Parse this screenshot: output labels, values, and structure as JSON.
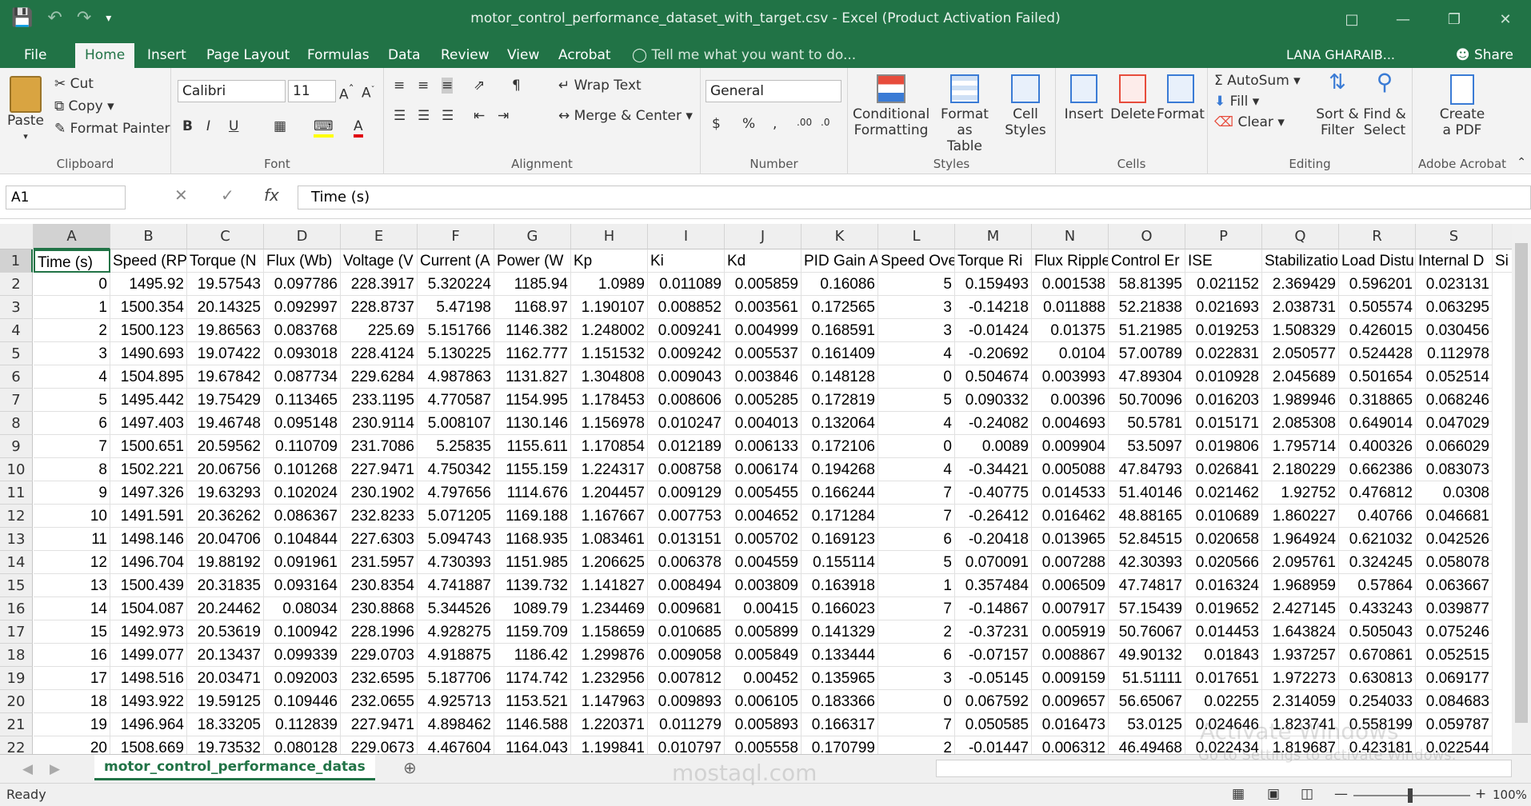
{
  "window": {
    "title": "motor_control_performance_dataset_with_target.csv - Excel (Product Activation Failed)",
    "user": "LANA GHARAIB...",
    "share_label": "Share"
  },
  "tabs": [
    "File",
    "Home",
    "Insert",
    "Page Layout",
    "Formulas",
    "Data",
    "Review",
    "View",
    "Acrobat"
  ],
  "tell_me": "Tell me what you want to do...",
  "ribbon": {
    "clipboard": {
      "paste": "Paste",
      "cut": "Cut",
      "copy": "Copy",
      "format_painter": "Format Painter",
      "label": "Clipboard"
    },
    "font": {
      "name": "Calibri",
      "size": "11",
      "label": "Font"
    },
    "alignment": {
      "wrap": "Wrap Text",
      "merge": "Merge & Center",
      "label": "Alignment"
    },
    "number": {
      "format": "General",
      "label": "Number"
    },
    "styles": {
      "conditional": "Conditional",
      "conditional2": "Formatting",
      "format_table": "Format as",
      "format_table2": "Table",
      "cell_styles": "Cell",
      "cell_styles2": "Styles",
      "label": "Styles"
    },
    "cells": {
      "insert": "Insert",
      "delete": "Delete",
      "format": "Format",
      "label": "Cells"
    },
    "editing": {
      "autosum": "AutoSum",
      "fill": "Fill",
      "clear": "Clear",
      "sort": "Sort &",
      "sort2": "Filter",
      "find": "Find &",
      "find2": "Select",
      "label": "Editing"
    },
    "acrobat": {
      "create": "Create",
      "create2": "a PDF",
      "label": "Adobe Acrobat"
    }
  },
  "formula_bar": {
    "name_box": "A1",
    "formula": "Time (s)"
  },
  "columns": [
    "A",
    "B",
    "C",
    "D",
    "E",
    "F",
    "G",
    "H",
    "I",
    "J",
    "K",
    "L",
    "M",
    "N",
    "O",
    "P",
    "Q",
    "R",
    "S"
  ],
  "headers": [
    "Time (s)",
    "Speed (RP",
    "Torque (N",
    "Flux (Wb)",
    "Voltage (V",
    "Current (A",
    "Power (W",
    "Kp",
    "Ki",
    "Kd",
    "PID Gain A",
    "Speed Ove",
    "Torque Ri",
    "Flux Ripple",
    "Control Er",
    "ISE",
    "Stabilizatio",
    "Load Distu",
    "Internal D",
    "Si"
  ],
  "rows": [
    [
      "0",
      "1495.92",
      "19.57543",
      "0.097786",
      "228.3917",
      "5.320224",
      "1185.94",
      "1.0989",
      "0.011089",
      "0.005859",
      "0.16086",
      "5",
      "0.159493",
      "0.001538",
      "58.81395",
      "0.021152",
      "2.369429",
      "0.596201",
      "0.023131"
    ],
    [
      "1",
      "1500.354",
      "20.14325",
      "0.092997",
      "228.8737",
      "5.47198",
      "1168.97",
      "1.190107",
      "0.008852",
      "0.003561",
      "0.172565",
      "3",
      "-0.14218",
      "0.011888",
      "52.21838",
      "0.021693",
      "2.038731",
      "0.505574",
      "0.063295"
    ],
    [
      "2",
      "1500.123",
      "19.86563",
      "0.083768",
      "225.69",
      "5.151766",
      "1146.382",
      "1.248002",
      "0.009241",
      "0.004999",
      "0.168591",
      "3",
      "-0.01424",
      "0.01375",
      "51.21985",
      "0.019253",
      "1.508329",
      "0.426015",
      "0.030456"
    ],
    [
      "3",
      "1490.693",
      "19.07422",
      "0.093018",
      "228.4124",
      "5.130225",
      "1162.777",
      "1.151532",
      "0.009242",
      "0.005537",
      "0.161409",
      "4",
      "-0.20692",
      "0.0104",
      "57.00789",
      "0.022831",
      "2.050577",
      "0.524428",
      "0.112978"
    ],
    [
      "4",
      "1504.895",
      "19.67842",
      "0.087734",
      "229.6284",
      "4.987863",
      "1131.827",
      "1.304808",
      "0.009043",
      "0.003846",
      "0.148128",
      "0",
      "0.504674",
      "0.003993",
      "47.89304",
      "0.010928",
      "2.045689",
      "0.501654",
      "0.052514"
    ],
    [
      "5",
      "1495.442",
      "19.75429",
      "0.113465",
      "233.1195",
      "4.770587",
      "1154.995",
      "1.178453",
      "0.008606",
      "0.005285",
      "0.172819",
      "5",
      "0.090332",
      "0.00396",
      "50.70096",
      "0.016203",
      "1.989946",
      "0.318865",
      "0.068246"
    ],
    [
      "6",
      "1497.403",
      "19.46748",
      "0.095148",
      "230.9114",
      "5.008107",
      "1130.146",
      "1.156978",
      "0.010247",
      "0.004013",
      "0.132064",
      "4",
      "-0.24082",
      "0.004693",
      "50.5781",
      "0.015171",
      "2.085308",
      "0.649014",
      "0.047029"
    ],
    [
      "7",
      "1500.651",
      "20.59562",
      "0.110709",
      "231.7086",
      "5.25835",
      "1155.611",
      "1.170854",
      "0.012189",
      "0.006133",
      "0.172106",
      "0",
      "0.0089",
      "0.009904",
      "53.5097",
      "0.019806",
      "1.795714",
      "0.400326",
      "0.066029"
    ],
    [
      "8",
      "1502.221",
      "20.06756",
      "0.101268",
      "227.9471",
      "4.750342",
      "1155.159",
      "1.224317",
      "0.008758",
      "0.006174",
      "0.194268",
      "4",
      "-0.34421",
      "0.005088",
      "47.84793",
      "0.026841",
      "2.180229",
      "0.662386",
      "0.083073"
    ],
    [
      "9",
      "1497.326",
      "19.63293",
      "0.102024",
      "230.1902",
      "4.797656",
      "1114.676",
      "1.204457",
      "0.009129",
      "0.005455",
      "0.166244",
      "7",
      "-0.40775",
      "0.014533",
      "51.40146",
      "0.021462",
      "1.92752",
      "0.476812",
      "0.0308"
    ],
    [
      "10",
      "1491.591",
      "20.36262",
      "0.086367",
      "232.8233",
      "5.071205",
      "1169.188",
      "1.167667",
      "0.007753",
      "0.004652",
      "0.171284",
      "7",
      "-0.26412",
      "0.016462",
      "48.88165",
      "0.010689",
      "1.860227",
      "0.40766",
      "0.046681"
    ],
    [
      "11",
      "1498.146",
      "20.04706",
      "0.104844",
      "227.6303",
      "5.094743",
      "1168.935",
      "1.083461",
      "0.013151",
      "0.005702",
      "0.169123",
      "6",
      "-0.20418",
      "0.013965",
      "52.84515",
      "0.020658",
      "1.964924",
      "0.621032",
      "0.042526"
    ],
    [
      "12",
      "1496.704",
      "19.88192",
      "0.091961",
      "231.5957",
      "4.730393",
      "1151.985",
      "1.206625",
      "0.006378",
      "0.004559",
      "0.155114",
      "5",
      "0.070091",
      "0.007288",
      "42.30393",
      "0.020566",
      "2.095761",
      "0.324245",
      "0.058078"
    ],
    [
      "13",
      "1500.439",
      "20.31835",
      "0.093164",
      "230.8354",
      "4.741887",
      "1139.732",
      "1.141827",
      "0.008494",
      "0.003809",
      "0.163918",
      "1",
      "0.357484",
      "0.006509",
      "47.74817",
      "0.016324",
      "1.968959",
      "0.57864",
      "0.063667"
    ],
    [
      "14",
      "1504.087",
      "20.24462",
      "0.08034",
      "230.8868",
      "5.344526",
      "1089.79",
      "1.234469",
      "0.009681",
      "0.00415",
      "0.166023",
      "7",
      "-0.14867",
      "0.007917",
      "57.15439",
      "0.019652",
      "2.427145",
      "0.433243",
      "0.039877"
    ],
    [
      "15",
      "1492.973",
      "20.53619",
      "0.100942",
      "228.1996",
      "4.928275",
      "1159.709",
      "1.158659",
      "0.010685",
      "0.005899",
      "0.141329",
      "2",
      "-0.37231",
      "0.005919",
      "50.76067",
      "0.014453",
      "1.643824",
      "0.505043",
      "0.075246"
    ],
    [
      "16",
      "1499.077",
      "20.13437",
      "0.099339",
      "229.0703",
      "4.918875",
      "1186.42",
      "1.299876",
      "0.009058",
      "0.005849",
      "0.133444",
      "6",
      "-0.07157",
      "0.008867",
      "49.90132",
      "0.01843",
      "1.937257",
      "0.670861",
      "0.052515"
    ],
    [
      "17",
      "1498.516",
      "20.03471",
      "0.092003",
      "232.6595",
      "5.187706",
      "1174.742",
      "1.232956",
      "0.007812",
      "0.00452",
      "0.135965",
      "3",
      "-0.05145",
      "0.009159",
      "51.51111",
      "0.017651",
      "1.972273",
      "0.630813",
      "0.069177"
    ],
    [
      "18",
      "1493.922",
      "19.59125",
      "0.109446",
      "232.0655",
      "4.925713",
      "1153.521",
      "1.147963",
      "0.009893",
      "0.006105",
      "0.183366",
      "0",
      "0.067592",
      "0.009657",
      "56.65067",
      "0.02255",
      "2.314059",
      "0.254033",
      "0.084683"
    ],
    [
      "19",
      "1496.964",
      "18.33205",
      "0.112839",
      "227.9471",
      "4.898462",
      "1146.588",
      "1.220371",
      "0.011279",
      "0.005893",
      "0.166317",
      "7",
      "0.050585",
      "0.016473",
      "53.0125",
      "0.024646",
      "1.823741",
      "0.558199",
      "0.059787"
    ],
    [
      "20",
      "1508.669",
      "19.73532",
      "0.080128",
      "229.0673",
      "4.467604",
      "1164.043",
      "1.199841",
      "0.010797",
      "0.005558",
      "0.170799",
      "2",
      "-0.01447",
      "0.006312",
      "46.49468",
      "0.022434",
      "1.819687",
      "0.423181",
      "0.022544"
    ]
  ],
  "sheet_tab": "motor_control_performance_datas",
  "status": {
    "ready": "Ready",
    "zoom": "100%"
  },
  "watermark": {
    "activate": "Activate Windows",
    "activate_sub": "Go to Settings to activate Windows.",
    "site": "mostaql.com"
  },
  "colors": {
    "accent": "#217346"
  }
}
